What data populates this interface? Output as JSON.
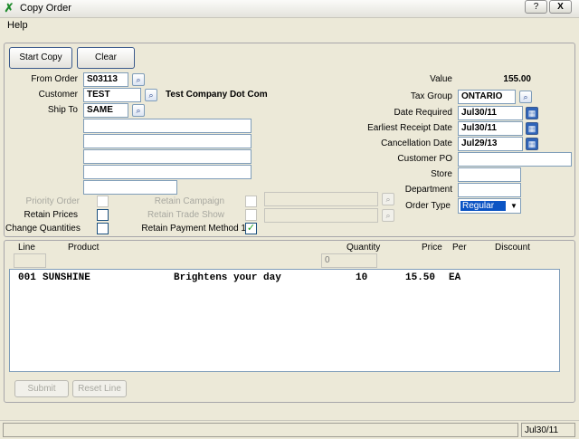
{
  "window": {
    "title": "Copy Order",
    "help_btn": "?",
    "close_btn": "X"
  },
  "menu": {
    "help": "Help"
  },
  "buttons": {
    "start_copy": "Start Copy",
    "clear": "Clear",
    "submit": "Submit",
    "reset_line": "Reset Line"
  },
  "left": {
    "from_order_label": "From Order",
    "from_order": "S03113",
    "customer_label": "Customer",
    "customer": "TEST",
    "customer_name": "Test Company Dot Com",
    "ship_to_label": "Ship To",
    "ship_to": "SAME",
    "address_lines": [
      "",
      "",
      "",
      "",
      ""
    ]
  },
  "options": {
    "priority_order": "Priority Order",
    "retain_prices": "Retain Prices",
    "change_quantities": "Change Quantities",
    "retain_campaign": "Retain Campaign",
    "retain_trade_show": "Retain Trade Show",
    "retain_payment_method": "Retain Payment Method 1"
  },
  "right": {
    "value_label": "Value",
    "value": "155.00",
    "tax_group_label": "Tax Group",
    "tax_group": "ONTARIO",
    "date_required_label": "Date Required",
    "date_required": "Jul30/11",
    "earliest_receipt_label": "Earliest Receipt Date",
    "earliest_receipt": "Jul30/11",
    "cancellation_label": "Cancellation Date",
    "cancellation": "Jul29/13",
    "customer_po_label": "Customer PO",
    "customer_po": "",
    "store_label": "Store",
    "store": "",
    "department_label": "Department",
    "department": "",
    "order_type_label": "Order Type",
    "order_type": "Regular"
  },
  "lines": {
    "headers": {
      "line": "Line",
      "product": "Product",
      "quantity": "Quantity",
      "price": "Price",
      "per": "Per",
      "discount": "Discount"
    },
    "quantity_input": "0",
    "rows": [
      {
        "line": "001",
        "product": "SUNSHINE",
        "description": "Brightens your day",
        "quantity": "10",
        "price": "15.50",
        "per": "EA"
      }
    ]
  },
  "status": {
    "date": "Jul30/11"
  },
  "colors": {
    "accent": "#0b54c4",
    "field_border": "#7f9db9",
    "check": "#21a121"
  }
}
